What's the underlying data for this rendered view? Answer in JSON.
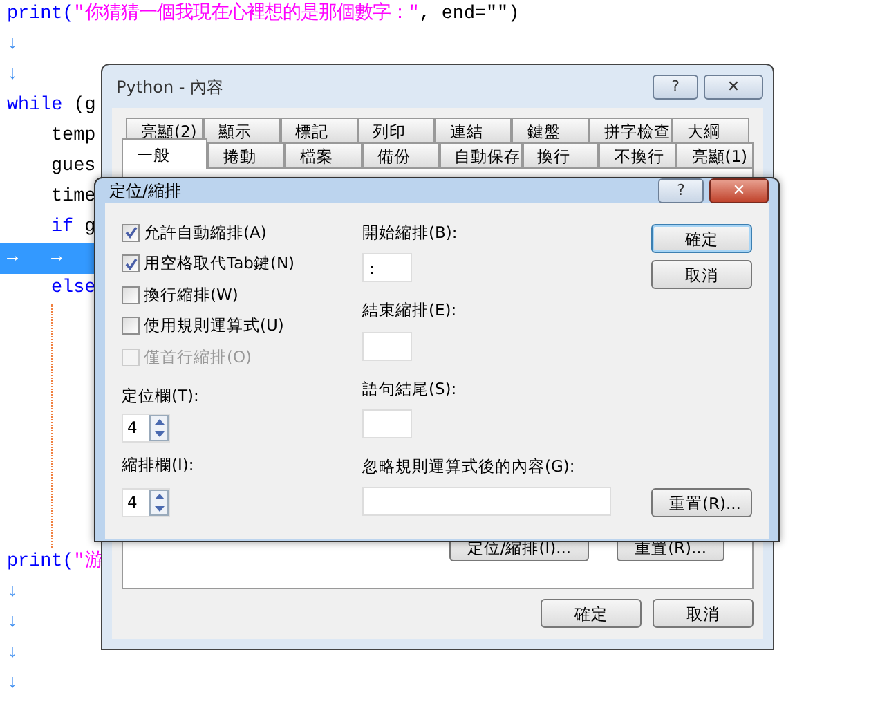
{
  "editor": {
    "lines": [
      {
        "kind": "code",
        "indented": false,
        "selected": false,
        "segments": [
          {
            "kind": "keyword",
            "text": "print("
          },
          {
            "kind": "string",
            "text": "\"你猜猜一個我現在心裡想的是那個數字：\""
          },
          {
            "kind": "plain",
            "text": ", end=\"\")"
          }
        ]
      },
      {
        "kind": "code",
        "indented": false,
        "selected": false,
        "segments": [
          {
            "kind": "mark",
            "text": "↓"
          }
        ]
      },
      {
        "kind": "code",
        "indented": false,
        "selected": false,
        "segments": [
          {
            "kind": "mark",
            "text": "↓"
          }
        ]
      },
      {
        "kind": "code",
        "indented": false,
        "selected": false,
        "segments": [
          {
            "kind": "keyword",
            "text": "while"
          },
          {
            "kind": "plain",
            "text": " (g"
          }
        ]
      },
      {
        "kind": "code",
        "indented": true,
        "selected": false,
        "segments": [
          {
            "kind": "plain",
            "text": "temp"
          }
        ]
      },
      {
        "kind": "code",
        "indented": true,
        "selected": false,
        "segments": [
          {
            "kind": "plain",
            "text": "gues"
          }
        ]
      },
      {
        "kind": "code",
        "indented": true,
        "selected": false,
        "segments": [
          {
            "kind": "plain",
            "text": "time"
          }
        ]
      },
      {
        "kind": "code",
        "indented": true,
        "selected": false,
        "segments": [
          {
            "kind": "keyword",
            "text": "if"
          },
          {
            "kind": "plain",
            "text": " g"
          }
        ]
      },
      {
        "kind": "tabs",
        "indented": false,
        "selected": true,
        "segments": [
          {
            "kind": "mark",
            "text": "→"
          },
          {
            "kind": "mark",
            "text": "→"
          }
        ]
      },
      {
        "kind": "code",
        "indented": true,
        "selected": false,
        "segments": [
          {
            "kind": "keyword",
            "text": "else"
          }
        ]
      },
      {
        "kind": "guide"
      },
      {
        "kind": "code",
        "indented": false,
        "selected": false,
        "segments": [
          {
            "kind": "keyword",
            "text": "print("
          },
          {
            "kind": "string",
            "text": "\"游"
          }
        ]
      },
      {
        "kind": "code",
        "indented": false,
        "selected": false,
        "segments": [
          {
            "kind": "mark",
            "text": "↓"
          }
        ]
      },
      {
        "kind": "code",
        "indented": false,
        "selected": false,
        "segments": [
          {
            "kind": "mark",
            "text": "↓"
          }
        ]
      },
      {
        "kind": "code",
        "indented": false,
        "selected": false,
        "segments": [
          {
            "kind": "mark",
            "text": "↓"
          }
        ]
      },
      {
        "kind": "code",
        "indented": false,
        "selected": false,
        "segments": [
          {
            "kind": "mark",
            "text": "↓"
          }
        ]
      }
    ]
  },
  "properties_dialog": {
    "title": "Python - 內容",
    "help_button": "?",
    "close_button": "✕",
    "tab_rows": [
      [
        {
          "label": "亮顯(2)",
          "selected": false
        },
        {
          "label": "顯示",
          "selected": false
        },
        {
          "label": "標記",
          "selected": false
        },
        {
          "label": "列印",
          "selected": false
        },
        {
          "label": "連結",
          "selected": false
        },
        {
          "label": "鍵盤",
          "selected": false
        },
        {
          "label": "拼字檢查",
          "selected": false
        },
        {
          "label": "大綱",
          "selected": false
        }
      ],
      [
        {
          "label": "一般",
          "selected": true
        },
        {
          "label": "捲動",
          "selected": false
        },
        {
          "label": "檔案",
          "selected": false
        },
        {
          "label": "備份",
          "selected": false
        },
        {
          "label": "自動保存",
          "selected": false
        },
        {
          "label": "換行",
          "selected": false
        },
        {
          "label": "不換行",
          "selected": false
        },
        {
          "label": "亮顯(1)",
          "selected": false
        }
      ]
    ],
    "panel_buttons": [
      "定位/縮排(I)...",
      "重置(R)..."
    ],
    "buttons": [
      "確定",
      "取消"
    ]
  },
  "indent_dialog": {
    "title": "定位/縮排",
    "help_button": "?",
    "close_button": "✕",
    "checkboxes": [
      {
        "label": "允許自動縮排(A)",
        "checked": true,
        "disabled": false
      },
      {
        "label": "用空格取代Tab鍵(N)",
        "checked": true,
        "disabled": false
      },
      {
        "label": "換行縮排(W)",
        "checked": false,
        "disabled": false
      },
      {
        "label": "使用規則運算式(U)",
        "checked": false,
        "disabled": false
      },
      {
        "label": "僅首行縮排(O)",
        "checked": false,
        "disabled": true
      }
    ],
    "spinners": [
      {
        "label": "定位欄(T):",
        "value": "4"
      },
      {
        "label": "縮排欄(I):",
        "value": "4"
      }
    ],
    "fields": [
      {
        "label": "開始縮排(B):",
        "value": ":",
        "wide": false
      },
      {
        "label": "結束縮排(E):",
        "wide": false
      },
      {
        "label": "語句結尾(S):",
        "wide": false
      },
      {
        "label": "忽略規則運算式後的內容(G):",
        "wide": true
      }
    ],
    "buttons": [
      {
        "label": "確定",
        "default": true
      },
      {
        "label": "取消",
        "default": false
      }
    ],
    "reset_button": "重置(R)..."
  }
}
